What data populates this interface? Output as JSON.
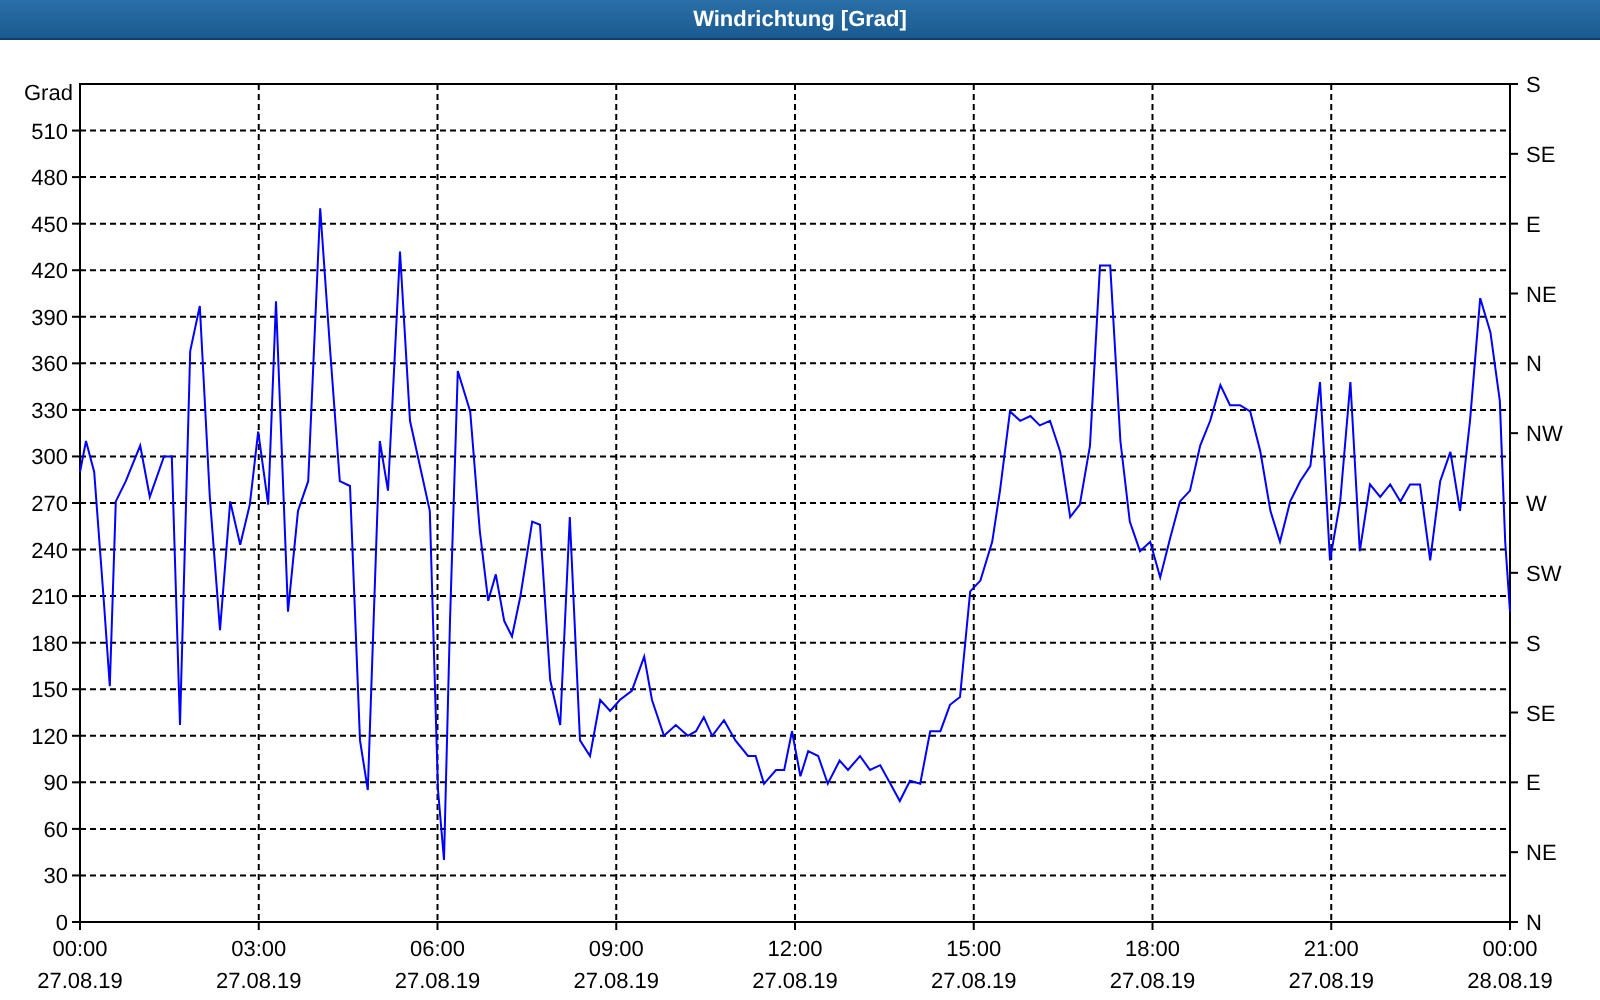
{
  "window": {
    "title": "Windrichtung [Grad]"
  },
  "chart": {
    "chart_data": {
      "type": "line",
      "ylabel": "Grad",
      "xlim": [
        0,
        24
      ],
      "ylim": [
        0,
        540
      ],
      "x": [
        0,
        0.1,
        0.24,
        0.4,
        0.5,
        0.6,
        0.77,
        1.01,
        1.17,
        1.41,
        1.54,
        1.68,
        1.85,
        2.01,
        2.18,
        2.35,
        2.52,
        2.69,
        2.85,
        2.99,
        3.16,
        3.29,
        3.49,
        3.66,
        3.83,
        4.03,
        4.2,
        4.36,
        4.53,
        4.7,
        4.83,
        5.03,
        5.17,
        5.37,
        5.54,
        5.87,
        6.01,
        6.11,
        6.21,
        6.34,
        6.55,
        6.71,
        6.85,
        6.98,
        7.12,
        7.25,
        7.39,
        7.59,
        7.72,
        7.89,
        8.06,
        8.22,
        8.39,
        8.56,
        8.73,
        8.9,
        9.06,
        9.26,
        9.47,
        9.6,
        9.8,
        10.0,
        10.2,
        10.34,
        10.47,
        10.61,
        10.81,
        11.0,
        11.21,
        11.34,
        11.48,
        11.68,
        11.82,
        11.95,
        12.09,
        12.22,
        12.39,
        12.55,
        12.75,
        12.89,
        13.09,
        13.26,
        13.43,
        13.6,
        13.76,
        13.93,
        14.1,
        14.27,
        14.44,
        14.6,
        14.77,
        14.94,
        15.11,
        15.31,
        15.44,
        15.61,
        15.78,
        15.95,
        16.11,
        16.28,
        16.45,
        16.62,
        16.78,
        16.95,
        17.12,
        17.29,
        17.46,
        17.62,
        17.79,
        17.96,
        18.13,
        18.3,
        18.46,
        18.63,
        18.8,
        18.97,
        19.14,
        19.3,
        19.47,
        19.64,
        19.81,
        19.98,
        20.14,
        20.31,
        20.48,
        20.65,
        20.81,
        20.98,
        21.15,
        21.32,
        21.48,
        21.65,
        21.82,
        21.99,
        22.16,
        22.32,
        22.49,
        22.66,
        22.83,
        23.0,
        23.16,
        23.33,
        23.5,
        23.67,
        23.83,
        23.92,
        24.0
      ],
      "series": [
        {
          "color": "#0000ff",
          "values": [
            290,
            310,
            290,
            207,
            152,
            271,
            284,
            307,
            274,
            300,
            300,
            127,
            368,
            397,
            274,
            188,
            271,
            243,
            269,
            316,
            269,
            400,
            200,
            265,
            284,
            460,
            368,
            284,
            281,
            117,
            85,
            310,
            278,
            432,
            323,
            265,
            85,
            40,
            194,
            355,
            329,
            252,
            207,
            224,
            194,
            184,
            210,
            258,
            256,
            156,
            127,
            261,
            117,
            107,
            143,
            136,
            143,
            149,
            171,
            143,
            120,
            127,
            120,
            123,
            132,
            120,
            130,
            117,
            107,
            107,
            89,
            98,
            98,
            123,
            94,
            110,
            107,
            89,
            104,
            98,
            107,
            98,
            101,
            89,
            78,
            91,
            89,
            123,
            123,
            140,
            145,
            213,
            220,
            245,
            278,
            329,
            323,
            326,
            320,
            323,
            303,
            261,
            269,
            307,
            423,
            423,
            310,
            258,
            239,
            245,
            222,
            248,
            271,
            278,
            307,
            323,
            346,
            333,
            333,
            329,
            303,
            265,
            245,
            271,
            284,
            294,
            348,
            233,
            271,
            348,
            239,
            282,
            274,
            282,
            271,
            282,
            282,
            233,
            284,
            303,
            265,
            323,
            402,
            380,
            336,
            245,
            200
          ]
        }
      ],
      "grid": true,
      "xticks": [
        {
          "value": 0,
          "label": "00:00"
        },
        {
          "value": 3,
          "label": "03:00"
        },
        {
          "value": 6,
          "label": "06:00"
        },
        {
          "value": 9,
          "label": "09:00"
        },
        {
          "value": 12,
          "label": "12:00"
        },
        {
          "value": 15,
          "label": "15:00"
        },
        {
          "value": 18,
          "label": "18:00"
        },
        {
          "value": 21,
          "label": "21:00"
        },
        {
          "value": 24,
          "label": "00:00"
        }
      ],
      "yticks": [
        0,
        30,
        60,
        90,
        120,
        150,
        180,
        210,
        240,
        270,
        300,
        330,
        360,
        390,
        420,
        450,
        480,
        510
      ]
    },
    "x_date_labels": [
      "27.08.19",
      "27.08.19",
      "27.08.19",
      "27.08.19",
      "27.08.19",
      "27.08.19",
      "27.08.19",
      "27.08.19",
      "28.08.19"
    ],
    "right_axis_ticks": [
      "S",
      "SE",
      "E",
      "NE",
      "N",
      "NW",
      "W",
      "SW",
      "S",
      "SE",
      "E",
      "NE",
      "N"
    ]
  }
}
